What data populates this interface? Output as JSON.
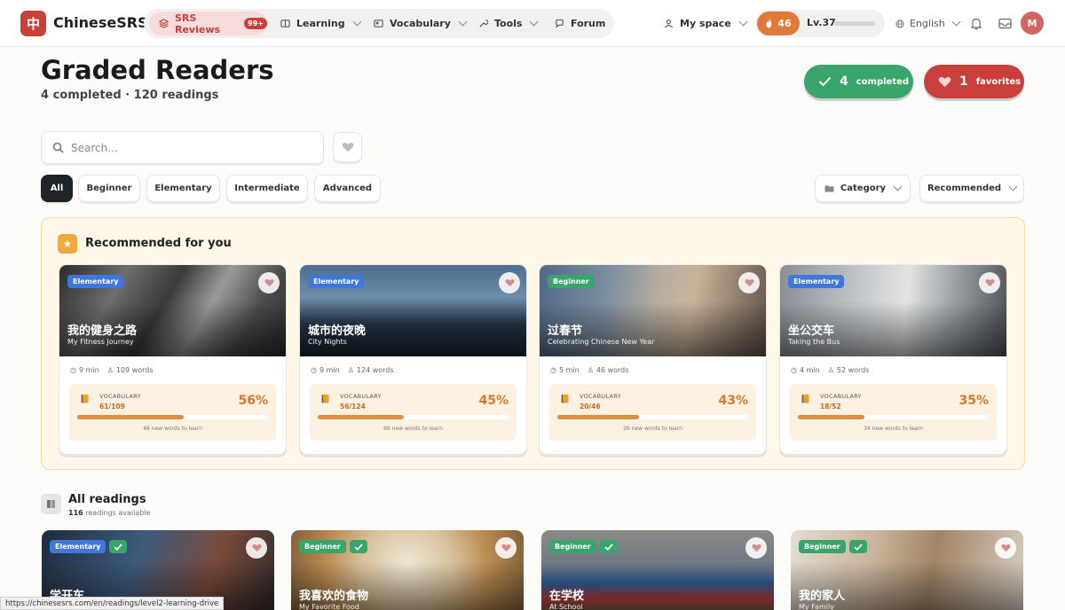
{
  "nav": {
    "logo_char": "中",
    "brand": "ChineseSRS",
    "srs_label": "SRS Reviews",
    "srs_badge": "99+",
    "learning": "Learning",
    "vocabulary": "Vocabulary",
    "tools": "Tools",
    "forum": "Forum",
    "my_space": "My space",
    "streak": "46",
    "level": "Lv.37",
    "level_progress": 0.0,
    "language": "English",
    "avatar_initial": "M"
  },
  "header": {
    "title": "Graded Readers",
    "subtitle": "4 completed · 120 readings",
    "completed_num": "4",
    "completed_label": "completed",
    "favorites_num": "1",
    "favorites_label": "favorites"
  },
  "search": {
    "placeholder": "Search..."
  },
  "filters": {
    "all": "All",
    "beginner": "Beginner",
    "elementary": "Elementary",
    "intermediate": "Intermediate",
    "advanced": "Advanced",
    "category": "Category",
    "sort": "Recommended"
  },
  "recommended": {
    "title": "Recommended for you",
    "cards": [
      {
        "level": "Elementary",
        "zh": "我的健身之路",
        "en": "My Fitness Journey",
        "minutes": "9 min",
        "words": "109 words",
        "vocab_label": "VOCABULARY",
        "vocab_count": "61/109",
        "percent": "56%",
        "progress": 0.56,
        "note": "48 new words to learn"
      },
      {
        "level": "Elementary",
        "zh": "城市的夜晚",
        "en": "City Nights",
        "minutes": "9 min",
        "words": "124 words",
        "vocab_label": "VOCABULARY",
        "vocab_count": "56/124",
        "percent": "45%",
        "progress": 0.45,
        "note": "68 new words to learn"
      },
      {
        "level": "Beginner",
        "zh": "过春节",
        "en": "Celebrating Chinese New Year",
        "minutes": "5 min",
        "words": "46 words",
        "vocab_label": "VOCABULARY",
        "vocab_count": "20/46",
        "percent": "43%",
        "progress": 0.43,
        "note": "26 new words to learn"
      },
      {
        "level": "Elementary",
        "zh": "坐公交车",
        "en": "Taking the Bus",
        "minutes": "4 min",
        "words": "52 words",
        "vocab_label": "VOCABULARY",
        "vocab_count": "18/52",
        "percent": "35%",
        "progress": 0.35,
        "note": "34 new words to learn"
      }
    ]
  },
  "all_readings": {
    "title": "All readings",
    "count": "116",
    "count_suffix": "readings available",
    "cards": [
      {
        "level": "Elementary",
        "zh": "学开车",
        "en": ""
      },
      {
        "level": "Beginner",
        "zh": "我喜欢的食物",
        "en": "My Favorite Food"
      },
      {
        "level": "Beginner",
        "zh": "在学校",
        "en": "At School"
      },
      {
        "level": "Beginner",
        "zh": "我的家人",
        "en": "My Family"
      }
    ]
  },
  "status_url": "https://chinesesrs.com/en/readings/level2-learning-drive",
  "colors": {
    "brand_red": "#c9403a",
    "success_green": "#3aa56b",
    "elementary_blue": "#3f78d8",
    "vocab_orange": "#d8792a"
  }
}
